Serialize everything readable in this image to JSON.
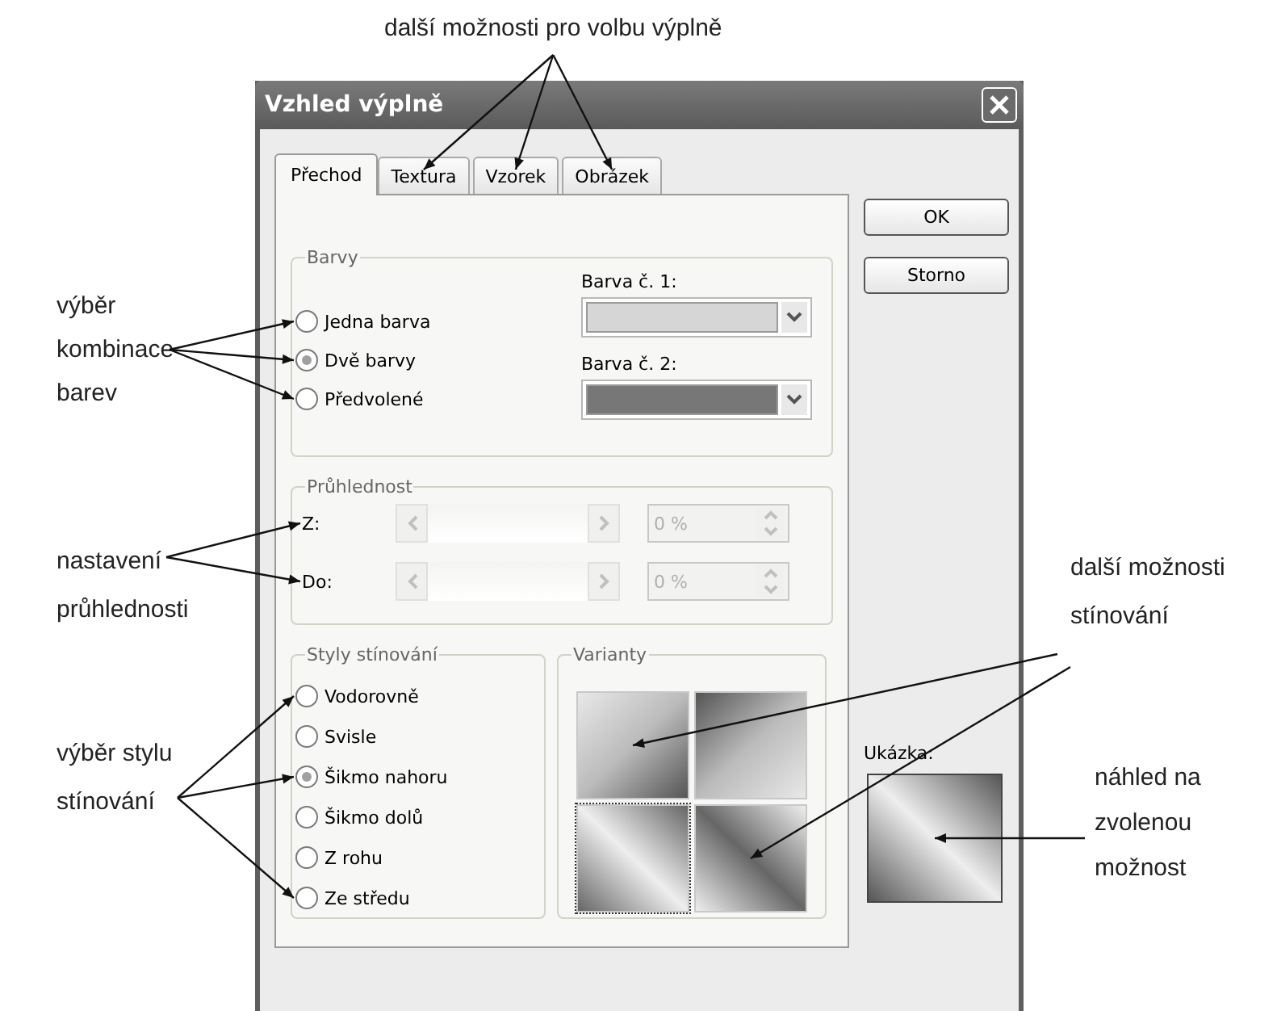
{
  "window": {
    "title": "Vzhled výplně"
  },
  "tabs": [
    {
      "label": "Přechod",
      "selected": true
    },
    {
      "label": "Textura",
      "selected": false
    },
    {
      "label": "Vzorek",
      "selected": false
    },
    {
      "label": "Obrázek",
      "selected": false
    }
  ],
  "buttons": [
    "OK",
    "Storno"
  ],
  "colors_group": {
    "label": "Barvy",
    "options": [
      {
        "label": "Jedna barva",
        "selected": false
      },
      {
        "label": "Dvě barvy",
        "selected": true
      },
      {
        "label": "Předvolené",
        "selected": false
      }
    ],
    "pickers": [
      {
        "label": "Barva č. 1:",
        "color": "#d6d6d6"
      },
      {
        "label": "Barva č. 2:",
        "color": "#777777"
      }
    ]
  },
  "transparency_group": {
    "label": "Průhlednost",
    "rows": [
      {
        "label": "Z:",
        "value": "0 %",
        "disabled": true
      },
      {
        "label": "Do:",
        "value": "0 %",
        "disabled": true
      }
    ]
  },
  "shading_group": {
    "label": "Styly stínování",
    "options": [
      {
        "label": "Vodorovně",
        "selected": false
      },
      {
        "label": "Svisle",
        "selected": false
      },
      {
        "label": "Šikmo nahoru",
        "selected": true
      },
      {
        "label": "Šikmo dolů",
        "selected": false
      },
      {
        "label": "Z rohu",
        "selected": false
      },
      {
        "label": "Ze středu",
        "selected": false
      }
    ]
  },
  "variants_group": {
    "label": "Varianty",
    "variants": [
      {
        "selected": false
      },
      {
        "selected": false
      },
      {
        "selected": true
      },
      {
        "selected": false
      }
    ]
  },
  "preview": {
    "label": "Ukázka:"
  },
  "annotations": [
    {
      "text": "další možnosti pro volbu výplně"
    },
    {
      "text": "výběr\nkombinace\nbarev"
    },
    {
      "text": "nastavení\nprůhlednosti"
    },
    {
      "text": "výběr stylu\nstínování"
    },
    {
      "text": "další možnosti\nstínování"
    },
    {
      "text": "náhled na\nzvolenou\nmožnost"
    }
  ]
}
